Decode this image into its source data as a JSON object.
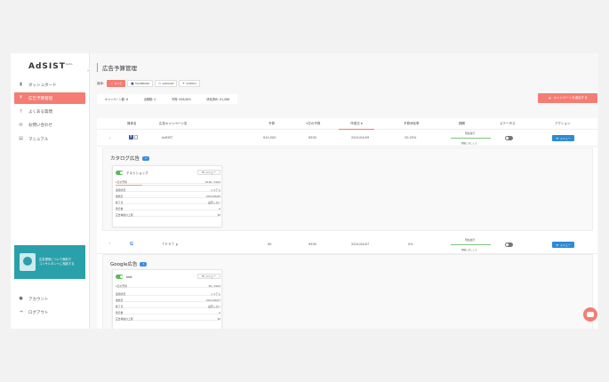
{
  "app": {
    "logo": "AdSIST",
    "logo_beta": "beta"
  },
  "sidebar": {
    "items": [
      {
        "label": "ダッシュボード",
        "icon": "chart-icon",
        "active": false
      },
      {
        "label": "広告予算管理",
        "icon": "yen-icon",
        "active": true
      },
      {
        "label": "よくある質問",
        "icon": "question-icon",
        "active": false
      },
      {
        "label": "お問い合わせ",
        "icon": "mail-icon",
        "active": false
      },
      {
        "label": "マニュアル",
        "icon": "document-icon",
        "active": false
      }
    ],
    "banner": {
      "line1": "広告運用について無料で",
      "line2": "コンサルタントに相談する"
    },
    "bottom": [
      {
        "label": "アカウント",
        "icon": "account-icon"
      },
      {
        "label": "ログアウト",
        "icon": "logout-icon"
      }
    ]
  },
  "header": {
    "title": "広告予算管理"
  },
  "filter": {
    "label": "媒体:",
    "chips": [
      {
        "label": "すべて",
        "active": true,
        "icon": "check-icon"
      },
      {
        "label": "FACEBOOK",
        "active": false,
        "icon": "facebook-icon"
      },
      {
        "label": "GOOGLE",
        "active": false,
        "icon": "google-icon"
      },
      {
        "label": "YAHOO!",
        "active": false,
        "icon": "yahoo-icon"
      }
    ]
  },
  "stats": {
    "campaigns": "キャンペーン数: 8",
    "active": "出稿数: 0",
    "budget": "予算: ¥46,800",
    "spend": "消化済み: ¥1,086"
  },
  "add_campaign_label": "キャンペーンを追加する",
  "table": {
    "headers": [
      "媒体名",
      "広告キャンペーン名",
      "予算",
      "1日の予算",
      "作成日",
      "予算消化率",
      "期間",
      "ステータス",
      "アクション"
    ],
    "sort_indicator": "▼",
    "rows": [
      {
        "name": "AdSIST",
        "budget": "¥10,500",
        "daily": "¥500",
        "created": "2021/04/09",
        "rate": "20.25%",
        "period_top": "現在進行",
        "period_bottom": "開始しましょう",
        "period_progress": 0.25,
        "menu": "メニュー",
        "group": {
          "title": "カタログ広告",
          "count": "1",
          "card": {
            "name": "テストショップ",
            "menu": "メニュー",
            "progress": 0.25,
            "rows": [
              {
                "k": "1日の予算",
                "v": "¥100 / ¥100"
              },
              {
                "k": "運用状況",
                "v": "システム"
              },
              {
                "k": "開始日",
                "v": "2021/04/09"
              },
              {
                "k": "終了日",
                "v": "設定しない"
              },
              {
                "k": "残日数",
                "v": "0"
              },
              {
                "k": "広告単価の上限",
                "v": "¥0"
              }
            ]
          }
        }
      },
      {
        "name": "ＴＥＳＴ ｐ",
        "budget": "¥0",
        "daily": "¥500",
        "created": "2021/04/07",
        "rate": "0%",
        "period_top": "現在進行",
        "period_bottom": "開始しましょう",
        "period_progress": 0.25,
        "menu": "メニュー",
        "group": {
          "title": "Google広告",
          "count": "1",
          "card": {
            "name": "test",
            "menu": "メニュー",
            "rows": [
              {
                "k": "1日の予算",
                "v": "¥0 / ¥100"
              },
              {
                "k": "運用状況",
                "v": "システム"
              },
              {
                "k": "開始日",
                "v": "2021/04/07"
              },
              {
                "k": "終了日",
                "v": "設定しない"
              },
              {
                "k": "残日数",
                "v": "0"
              },
              {
                "k": "広告単価の上限",
                "v": "¥0"
              }
            ]
          }
        }
      }
    ]
  },
  "colors": {
    "accent": "#f47c73",
    "blue": "#2e8ad8",
    "green": "#5cb85c",
    "teal": "#2aa0aa"
  }
}
